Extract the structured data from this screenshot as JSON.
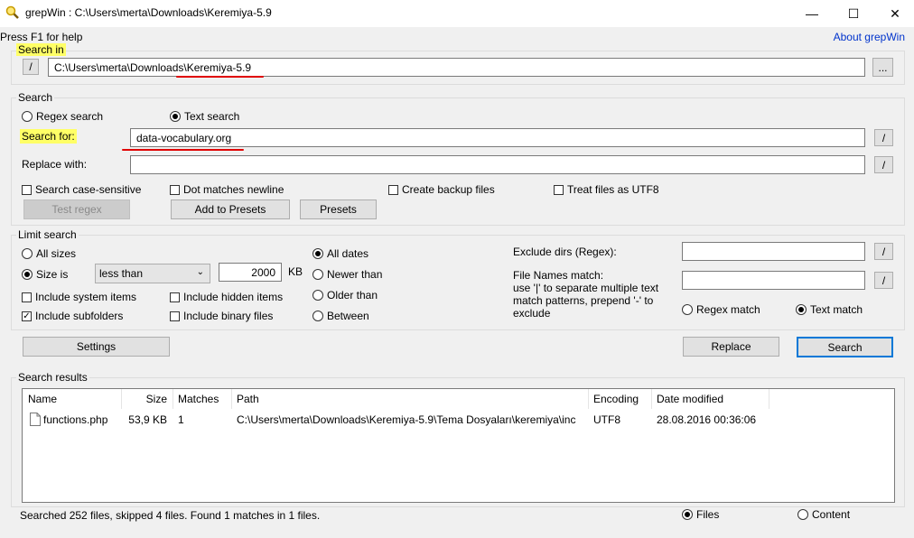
{
  "window": {
    "title": "grepWin : C:\\Users\\merta\\Downloads\\Keremiya-5.9",
    "controls": {
      "minimize": "—",
      "maximize": "☐",
      "close": "✕"
    }
  },
  "help_text": "Press F1 for help",
  "about_link": "About grepWin",
  "search_in": {
    "label": "Search in",
    "browse_button": "/",
    "path": "C:\\Users\\merta\\Downloads\\Keremiya-5.9",
    "ellipsis_button": "..."
  },
  "search": {
    "group_label": "Search",
    "regex_option": "Regex search",
    "text_option": "Text search",
    "search_for_label": "Search for:",
    "search_for_value": "data-vocabulary.org",
    "replace_with_label": "Replace with:",
    "replace_with_value": "",
    "slash_button": "/",
    "case_sensitive": "Search case-sensitive",
    "dot_newline": "Dot matches newline",
    "create_backup": "Create backup files",
    "treat_utf8": "Treat files as UTF8",
    "test_regex": "Test regex",
    "add_presets": "Add to Presets",
    "presets": "Presets"
  },
  "limit": {
    "group_label": "Limit search",
    "all_sizes": "All sizes",
    "size_is": "Size is",
    "size_op": "less than",
    "size_value": "2000",
    "size_unit": "KB",
    "all_dates": "All dates",
    "newer_than": "Newer than",
    "older_than": "Older than",
    "between": "Between",
    "include_system": "Include system items",
    "include_hidden": "Include hidden items",
    "include_subfolders": "Include subfolders",
    "include_binary": "Include binary files",
    "exclude_dirs_label": "Exclude dirs (Regex):",
    "file_names_label": "File Names match:",
    "file_names_hint": "use '|' to separate multiple text match patterns, prepend '-' to exclude",
    "regex_match": "Regex match",
    "text_match": "Text match"
  },
  "buttons": {
    "settings": "Settings",
    "replace": "Replace",
    "search": "Search"
  },
  "results": {
    "group_label": "Search results",
    "columns": [
      "Name",
      "Size",
      "Matches",
      "Path",
      "Encoding",
      "Date modified"
    ],
    "rows": [
      {
        "name": "functions.php",
        "size": "53,9 KB",
        "matches": "1",
        "path": "C:\\Users\\merta\\Downloads\\Keremiya-5.9\\Tema Dosyaları\\keremiya\\inc",
        "encoding": "UTF8",
        "date": "28.08.2016 00:36:06"
      }
    ]
  },
  "status": {
    "text": "Searched 252 files, skipped 4 files. Found 1 matches in 1 files.",
    "files_option": "Files",
    "content_option": "Content"
  },
  "colors": {
    "highlight": "#ffff66",
    "annotation_red": "#e00000",
    "accent": "#0078d7",
    "link": "#0033cc"
  }
}
